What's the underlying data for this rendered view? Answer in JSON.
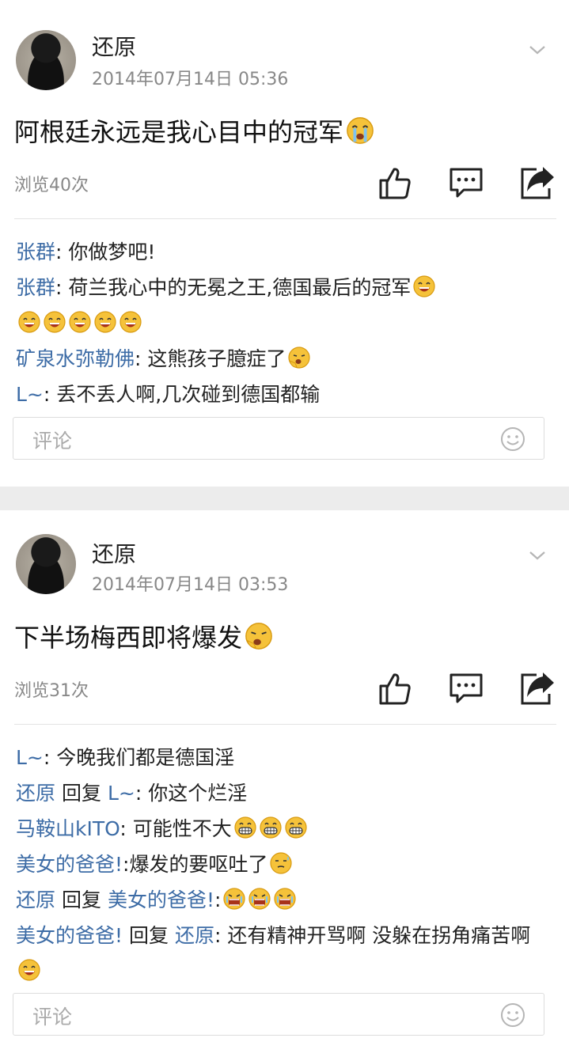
{
  "posts": [
    {
      "author": "还原",
      "timestamp": "2014年07月14日 05:36",
      "content": "阿根廷永远是我心目中的冠军",
      "views": "浏览40次",
      "comments": [
        {
          "user": "张群",
          "text": ": 你做梦吧!",
          "emojis": []
        },
        {
          "user": "张群",
          "text": ": 荷兰我心中的无冕之王,德国最后的冠军",
          "emojis": [
            "grin",
            "grin",
            "grin",
            "grin",
            "grin",
            "grin"
          ]
        },
        {
          "user": "矿泉水弥勒佛",
          "text": ": 这熊孩子臆症了",
          "emojis": [
            "yawn"
          ]
        },
        {
          "user": "L~",
          "text": ": 丢不丢人啊,几次碰到德国都输",
          "emojis": []
        }
      ],
      "comment_placeholder": "评论"
    },
    {
      "author": "还原",
      "timestamp": "2014年07月14日 03:53",
      "content": "下半场梅西即将爆发",
      "views": "浏览31次",
      "comments": [
        {
          "user": "L~",
          "text": ": 今晚我们都是德国淫",
          "emojis": []
        },
        {
          "user": "还原",
          "reply_word": "回复",
          "reply_to": "L~",
          "text": ": 你这个烂淫",
          "emojis": []
        },
        {
          "user": "马鞍山kITO",
          "text": ": 可能性不大",
          "emojis": [
            "teeth",
            "teeth",
            "teeth"
          ]
        },
        {
          "user": "美女的爸爸!",
          "text": ":爆发的要呕吐了",
          "emojis": [
            "sweat"
          ]
        },
        {
          "user": "还原",
          "reply_word": "回复",
          "reply_to": "美女的爸爸!",
          "text": ":",
          "emojis": [
            "angry",
            "angry",
            "angry"
          ]
        },
        {
          "user": "美女的爸爸!",
          "reply_word": "回复",
          "reply_to": "还原",
          "text": ": 还有精神开骂啊 没躲在拐角痛苦啊",
          "emojis": [
            "grin"
          ]
        }
      ],
      "comment_placeholder": "评论"
    }
  ],
  "icons": [
    "thumbs-up-icon",
    "comment-icon",
    "share-icon",
    "chevron-down-icon",
    "smiley-icon"
  ],
  "colors": {
    "username": "#3d6ca6",
    "meta": "#888888",
    "divider": "#e3e3e3",
    "emoji": "#f5b81d"
  }
}
